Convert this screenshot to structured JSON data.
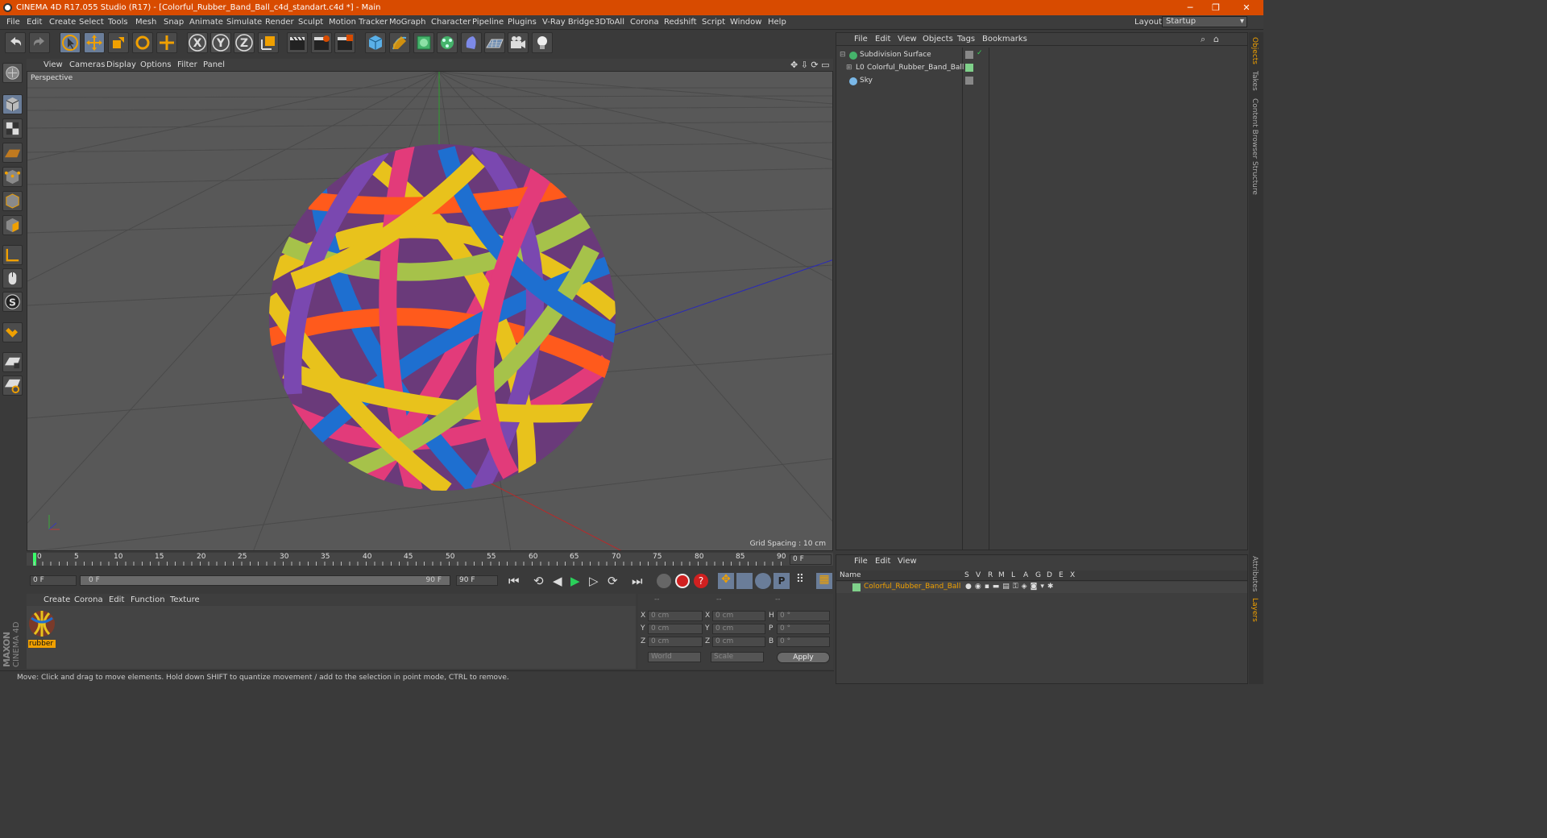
{
  "window": {
    "title": "CINEMA 4D R17.055 Studio (R17) - [Colorful_Rubber_Band_Ball_c4d_standart.c4d *] - Main",
    "controls": [
      "─",
      "❐",
      "✕"
    ]
  },
  "menu": {
    "items": [
      "File",
      "Edit",
      "Create",
      "Select",
      "Tools",
      "Mesh",
      "Snap",
      "Animate",
      "Simulate",
      "Render",
      "Sculpt",
      "Motion Tracker",
      "MoGraph",
      "Character",
      "Pipeline",
      "Plugins",
      "V-Ray Bridge",
      "3DToAll",
      "Corona",
      "Redshift",
      "Script",
      "Window",
      "Help"
    ],
    "layout_label": "Layout:",
    "layout_value": "Startup"
  },
  "toolbar": {
    "axis_x": "X",
    "axis_y": "Y",
    "axis_z": "Z"
  },
  "viewport": {
    "menu": [
      "View",
      "Cameras",
      "Display",
      "Options",
      "Filter",
      "Panel"
    ],
    "label": "Perspective",
    "grid_spacing": "Grid Spacing : 10 cm"
  },
  "timeline": {
    "ticks": [
      "0",
      "5",
      "10",
      "15",
      "20",
      "25",
      "30",
      "35",
      "40",
      "45",
      "50",
      "55",
      "60",
      "65",
      "70",
      "75",
      "80",
      "85",
      "90"
    ],
    "current_frame": "0 F",
    "start_field": "0 F",
    "range_start": "0 F",
    "range_end": "90 F",
    "end_field": "90 F"
  },
  "material_manager": {
    "menu": [
      "Create",
      "Corona",
      "Edit",
      "Function",
      "Texture"
    ],
    "material_name": "rubber"
  },
  "coord_manager": {
    "headers": [
      "--",
      "--",
      "--"
    ],
    "rows": [
      {
        "a": "X",
        "av": "0 cm",
        "b": "X",
        "bv": "0 cm",
        "c": "H",
        "cv": "0 °"
      },
      {
        "a": "Y",
        "av": "0 cm",
        "b": "Y",
        "bv": "0 cm",
        "c": "P",
        "cv": "0 °"
      },
      {
        "a": "Z",
        "av": "0 cm",
        "b": "Z",
        "bv": "0 cm",
        "c": "B",
        "cv": "0 °"
      }
    ],
    "world": "World",
    "scale": "Scale",
    "apply": "Apply"
  },
  "object_manager": {
    "menu": [
      "File",
      "Edit",
      "View",
      "Objects",
      "Tags",
      "Bookmarks"
    ],
    "objects": [
      "Subdivision Surface",
      "Colorful_Rubber_Band_Ball",
      "Sky"
    ]
  },
  "layer_manager": {
    "menu": [
      "File",
      "Edit",
      "View"
    ],
    "name_header": "Name",
    "columns": [
      "S",
      "V",
      "R",
      "M",
      "L",
      "A",
      "G",
      "D",
      "E",
      "X"
    ],
    "layer_name": "Colorful_Rubber_Band_Ball"
  },
  "side_tabs": [
    "Objects",
    "Takes",
    "Content Browser",
    "Structure"
  ],
  "side_tabs_bottom": [
    "Attributes",
    "Layers"
  ],
  "status": "Move: Click and drag to move elements. Hold down SHIFT to quantize movement / add to the selection in point mode, CTRL to remove.",
  "brand": {
    "maxon": "MAXON",
    "c4d": "CINEMA 4D"
  },
  "colors": {
    "title_bar": "#d84b00",
    "accent_orange": "#f0a000",
    "layer_green": "#7fd18a"
  }
}
